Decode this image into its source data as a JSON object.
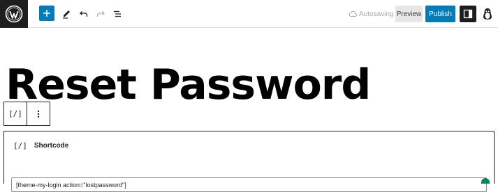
{
  "toolbar": {
    "autosave_label": "Autosaving",
    "preview_label": "Preview",
    "publish_label": "Publish"
  },
  "post": {
    "title": "Reset Password"
  },
  "shortcode_block": {
    "label": "Shortcode",
    "icon_glyph": "[/]",
    "value": "[theme-my-login action=\"lostpassword\"]"
  },
  "block_toolbar": {
    "block_icon_glyph": "[/]"
  },
  "colors": {
    "accent": "#007cba",
    "dark": "#1e1e1e",
    "muted": "#a7aaad"
  }
}
